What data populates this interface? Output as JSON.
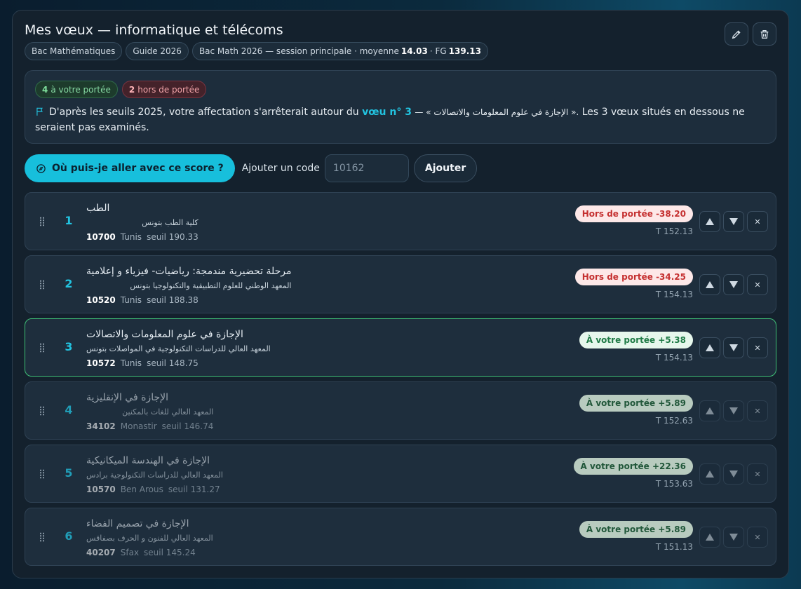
{
  "header": {
    "title": "Mes vœux — informatique et télécoms",
    "edit_icon": "pencil-icon",
    "delete_icon": "trash-icon"
  },
  "tags": {
    "section": "Bac Mathématiques",
    "guide": "Guide 2026",
    "session_prefix": "Bac Math 2026 — session principale · moyenne",
    "moyenne": "14.03",
    "fg_label": "· FG",
    "fg": "139.13"
  },
  "summary": {
    "in_reach_count": "4",
    "in_reach_label": "à votre portée",
    "out_reach_count": "2",
    "out_reach_label": "hors de portée",
    "message_before": "D'après les seuils 2025, votre affectation s'arrêterait autour du",
    "message_highlight": "vœu n° 3",
    "message_program": "— « الإجازة في علوم المعلومات والاتصالات ».",
    "message_after": "Les 3 vœux situés en dessous ne seraient pas examinés."
  },
  "actions": {
    "cta_label": "Où puis-je aller avec ce score ?",
    "add_label": "Ajouter un code",
    "code_placeholder": "10162",
    "add_button": "Ajouter"
  },
  "wishes": [
    {
      "rank": "1",
      "program": "الطب",
      "institution": "كلية الطب بتونس",
      "code": "10700",
      "city": "Tunis",
      "seuil": "seuil 190.33",
      "status": "Hors de portée -38.20",
      "total": "T 152.13"
    },
    {
      "rank": "2",
      "program": "مرحلة تحضيرية مندمجة: رياضيات- فيزياء و إعلامية",
      "institution": "المعهد الوطني للعلوم التطبيقية والتكنولوجيا بتونس",
      "code": "10520",
      "city": "Tunis",
      "seuil": "seuil 188.38",
      "status": "Hors de portée -34.25",
      "total": "T 154.13"
    },
    {
      "rank": "3",
      "program": "الإجازة في علوم المعلومات والاتصالات",
      "institution": "المعهد العالي للدراسات التكنولوجية في المواصلات بتونس",
      "code": "10572",
      "city": "Tunis",
      "seuil": "seuil 148.75",
      "status": "À votre portée +5.38",
      "total": "T 154.13"
    },
    {
      "rank": "4",
      "program": "الإجازة في الإنقليزية",
      "institution": "المعهد العالي للغات بالمكنين",
      "code": "34102",
      "city": "Monastir",
      "seuil": "seuil 146.74",
      "status": "À votre portée +5.89",
      "total": "T 152.63"
    },
    {
      "rank": "5",
      "program": "الإجازة في الهندسة الميكانيكية",
      "institution": "المعهد العالي للدراسات التكنولوجية برادس",
      "code": "10570",
      "city": "Ben Arous",
      "seuil": "seuil 131.27",
      "status": "À votre portée +22.36",
      "total": "T 153.63"
    },
    {
      "rank": "6",
      "program": "الإجازة في تصميم الفضاء",
      "institution": "المعهد العالي للفنون و الحرف بصفاقس",
      "code": "40207",
      "city": "Sfax",
      "seuil": "seuil 145.24",
      "status": "À votre portée +5.89",
      "total": "T 151.13"
    }
  ],
  "colors": {
    "accent": "#17bfdc",
    "out_of_reach": "#c53030",
    "in_reach": "#1e7a45",
    "current_border": "#3fbf76"
  }
}
